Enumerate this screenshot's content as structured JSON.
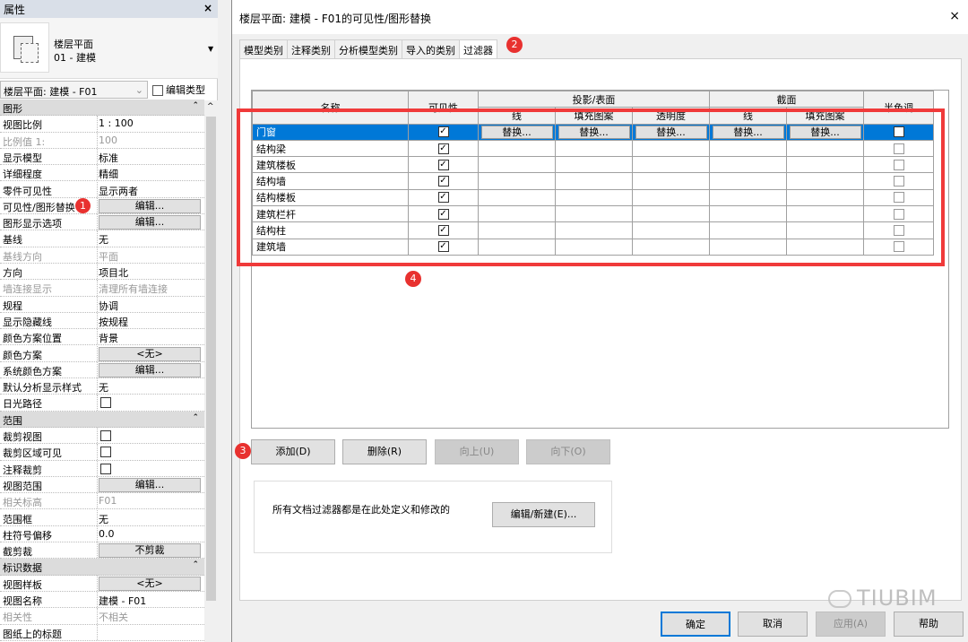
{
  "properties": {
    "title": "属性",
    "close": "×",
    "type_line1": "楼层平面",
    "type_line2": "01 - 建模",
    "selector": "楼层平面: 建模 - F01",
    "edit_type": "编辑类型",
    "rows": [
      {
        "s": "图形"
      },
      {
        "k": "视图比例",
        "v": "1 : 100"
      },
      {
        "k": "比例值 1:",
        "v": "100",
        "g": true
      },
      {
        "k": "显示模型",
        "v": "标准"
      },
      {
        "k": "详细程度",
        "v": "精细"
      },
      {
        "k": "零件可见性",
        "v": "显示两者"
      },
      {
        "k": "可见性/图形替换",
        "b": "编辑...",
        "badge": "1"
      },
      {
        "k": "图形显示选项",
        "b": "编辑..."
      },
      {
        "k": "基线",
        "v": "无"
      },
      {
        "k": "基线方向",
        "v": "平面",
        "g": true
      },
      {
        "k": "方向",
        "v": "项目北"
      },
      {
        "k": "墙连接显示",
        "v": "清理所有墙连接",
        "g": true
      },
      {
        "k": "规程",
        "v": "协调"
      },
      {
        "k": "显示隐藏线",
        "v": "按规程"
      },
      {
        "k": "颜色方案位置",
        "v": "背景"
      },
      {
        "k": "颜色方案",
        "b": "<无>"
      },
      {
        "k": "系统颜色方案",
        "b": "编辑..."
      },
      {
        "k": "默认分析显示样式",
        "v": "无"
      },
      {
        "k": "日光路径",
        "c": true
      },
      {
        "s": "范围"
      },
      {
        "k": "裁剪视图",
        "c": true
      },
      {
        "k": "裁剪区域可见",
        "c": true
      },
      {
        "k": "注释裁剪",
        "c": true
      },
      {
        "k": "视图范围",
        "b": "编辑..."
      },
      {
        "k": "相关标高",
        "v": "F01",
        "g": true
      },
      {
        "k": "范围框",
        "v": "无"
      },
      {
        "k": "柱符号偏移",
        "v": "0.0"
      },
      {
        "k": "截剪裁",
        "b": "不剪裁"
      },
      {
        "s": "标识数据"
      },
      {
        "k": "视图样板",
        "b": "<无>"
      },
      {
        "k": "视图名称",
        "v": "建模 - F01"
      },
      {
        "k": "相关性",
        "v": "不相关",
        "g": true
      },
      {
        "k": "图纸上的标题",
        "v": ""
      }
    ]
  },
  "dialog": {
    "title": "楼层平面: 建模 - F01的可见性/图形替换",
    "close": "×",
    "tabs": [
      "模型类别",
      "注释类别",
      "分析模型类别",
      "导入的类别",
      "过滤器"
    ],
    "tab_badge": "2",
    "headers": {
      "name": "名称",
      "visibility": "可见性",
      "projection": "投影/表面",
      "cut": "截面",
      "halftone": "半色调",
      "sub": [
        "线",
        "填充图案",
        "透明度",
        "线",
        "填充图案"
      ]
    },
    "override_label": "替换...",
    "filters": [
      {
        "name": "门窗",
        "visible": true,
        "halftone": false,
        "selected": true
      },
      {
        "name": "结构梁",
        "visible": true,
        "halftone": false
      },
      {
        "name": "建筑楼板",
        "visible": true,
        "halftone": false
      },
      {
        "name": "结构墙",
        "visible": true,
        "halftone": false
      },
      {
        "name": "结构楼板",
        "visible": true,
        "halftone": false
      },
      {
        "name": "建筑栏杆",
        "visible": true,
        "halftone": false
      },
      {
        "name": "结构柱",
        "visible": true,
        "halftone": false
      },
      {
        "name": "建筑墙",
        "visible": true,
        "halftone": false
      }
    ],
    "badge3": "3",
    "badge4": "4",
    "add": "添加(D)",
    "delete": "删除(R)",
    "up": "向上(U)",
    "down": "向下(O)",
    "info": "所有文档过滤器都是在此处定义和修改的",
    "edit_new": "编辑/新建(E)...",
    "ok": "确定",
    "cancel": "取消",
    "apply": "应用(A)",
    "help": "帮助"
  },
  "watermark": "TIUBIM",
  "colors": {
    "selection": "#0078d7",
    "highlight": "#f03a3a"
  }
}
